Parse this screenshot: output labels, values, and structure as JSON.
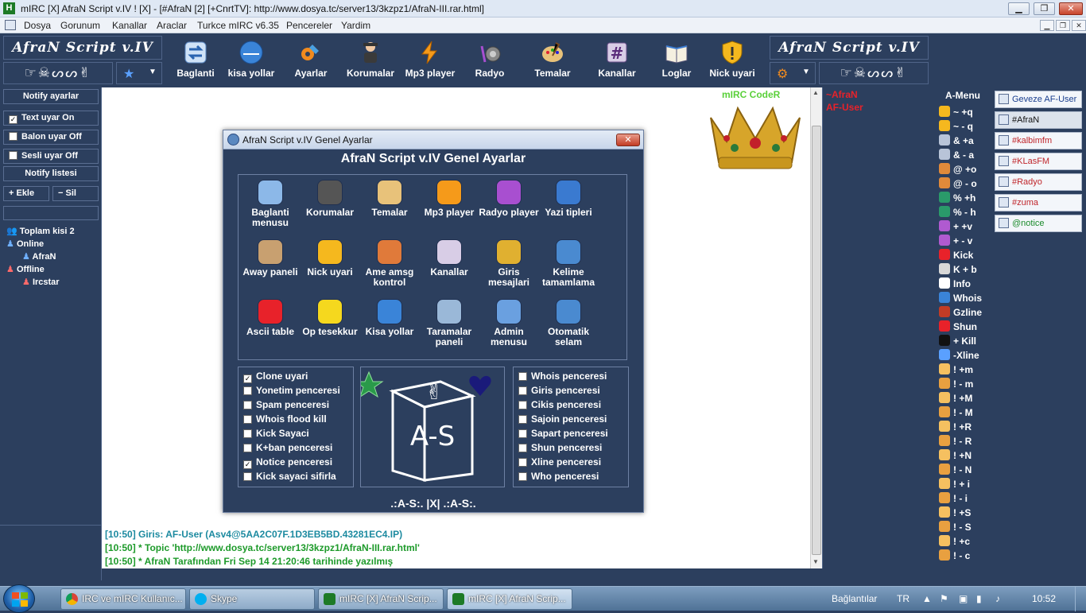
{
  "window": {
    "title": "mIRC [X] AfraN Script v.IV ! [X] - [#AfraN [2] [+CnrtTV]: http://www.dosya.tc/server13/3kzpz1/AfraN-III.rar.html]",
    "app_icon": "H"
  },
  "menu": [
    "Dosya",
    "Gorunum",
    "Kanallar",
    "Araclar",
    "Turkce mIRC v6.35",
    "Pencereler",
    "Yardim"
  ],
  "logo": {
    "left": "AfraN Script v.IV",
    "right": "AfraN Script v.IV",
    "symbols": "☞☠ᔕᔕ✌"
  },
  "toolbar": [
    "Baglanti",
    "kisa yollar",
    "Ayarlar",
    "Korumalar",
    "Mp3 player",
    "Radyo",
    "Temalar",
    "Kanallar",
    "Loglar",
    "Nick uyari"
  ],
  "left": {
    "notify_header": "Notify ayarlar",
    "text_uyar": "Text uyar On",
    "balon_uyar": "Balon uyar Off",
    "sesli_uyar": "Sesli uyar Off",
    "notify_list": "Notify listesi",
    "ekle": "+ Ekle",
    "sil": "− Sil",
    "toplam": "Toplam kisi 2",
    "online": "Online",
    "online_user": "AfraN",
    "offline": "Offline",
    "offline_user": "Ircstar"
  },
  "chat": {
    "banner": "mIRC CodeR",
    "lines": [
      "[10:50] Giris: AF-User (Asv4@5AA2C07F.1D3EB5BD.43281EC4.IP)",
      "[10:50] * Topic 'http://www.dosya.tc/server13/3kzpz1/AfraN-III.rar.html'",
      "[10:50] * AfraN Tarafından Fri Sep 14 21:20:46 tarihinde yazılmış"
    ]
  },
  "nicklist": [
    "~AfraN",
    "AF-User"
  ],
  "amenu": {
    "title": "A-Menu",
    "items": [
      "~ +q",
      "~ - q",
      "& +a",
      "& - a",
      "@ +o",
      "@ - o",
      "% +h",
      "% - h",
      "+ +v",
      "+ - v",
      "Kick",
      "K + b",
      "Info",
      "Whois",
      "Gzline",
      "Shun",
      "+ Kill",
      "-Xline",
      "! +m",
      "! - m",
      "! +M",
      "! - M",
      "! +R",
      "! - R",
      "! +N",
      "! - N",
      "! + i",
      "! - i",
      "! +S",
      "! - S",
      "! +c",
      "! - c"
    ]
  },
  "switchbar": [
    {
      "label": "Geveze AF-User",
      "color": "#1a3f8f"
    },
    {
      "label": "#AfraN",
      "color": "#111111"
    },
    {
      "label": "#kalbimfm",
      "color": "#c0262b"
    },
    {
      "label": "#KLasFM",
      "color": "#c0262b"
    },
    {
      "label": "#Radyo",
      "color": "#c0262b"
    },
    {
      "label": "#zuma",
      "color": "#c0262b"
    },
    {
      "label": "@notice",
      "color": "#1a8a2a"
    }
  ],
  "dialog": {
    "title": "AfraN Script v.IV Genel Ayarlar",
    "header": "AfraN Script v.IV Genel Ayarlar",
    "close": "✕",
    "grid": [
      [
        "Baglanti menusu",
        "Korumalar",
        "Temalar",
        "Mp3 player",
        "Radyo player",
        "Yazi tipleri"
      ],
      [
        "Away paneli",
        "Nick uyari",
        "Ame amsg kontrol",
        "Kanallar",
        "Giris mesajlari",
        "Kelime tamamlama"
      ],
      [
        "Ascii table",
        "Op tesekkur",
        "Kisa yollar",
        "Taramalar paneli",
        "Admin menusu",
        "Otomatik selam"
      ]
    ],
    "left_checks": [
      {
        "label": "Clone uyari",
        "checked": "✓"
      },
      {
        "label": "Yonetim penceresi",
        "checked": ""
      },
      {
        "label": "Spam penceresi",
        "checked": ""
      },
      {
        "label": "Whois flood kill",
        "checked": ""
      },
      {
        "label": "Kick Sayaci",
        "checked": ""
      },
      {
        "label": "K+ban penceresi",
        "checked": ""
      },
      {
        "label": "Notice penceresi",
        "checked": "✓"
      },
      {
        "label": "Kick sayaci sifirla",
        "checked": ""
      }
    ],
    "right_checks": [
      "Whois penceresi",
      "Giris penceresi",
      "Cikis penceresi",
      "Sajoin penceresi",
      "Sapart penceresi",
      "Shun penceresi",
      "Xline penceresi",
      "Who penceresi"
    ],
    "cube_text": "A-S",
    "footer": ".:A-S:. |X| .:A-S:."
  },
  "taskbar": {
    "tasks": [
      "IRC ve mIRC Kullanıc...",
      "Skype",
      "mIRC [X] AfraN Scrip...",
      "mIRC [X] AfraN Scrip..."
    ],
    "baglantilar": "Bağlantılar",
    "lang": "TR",
    "clock": "10:52"
  }
}
